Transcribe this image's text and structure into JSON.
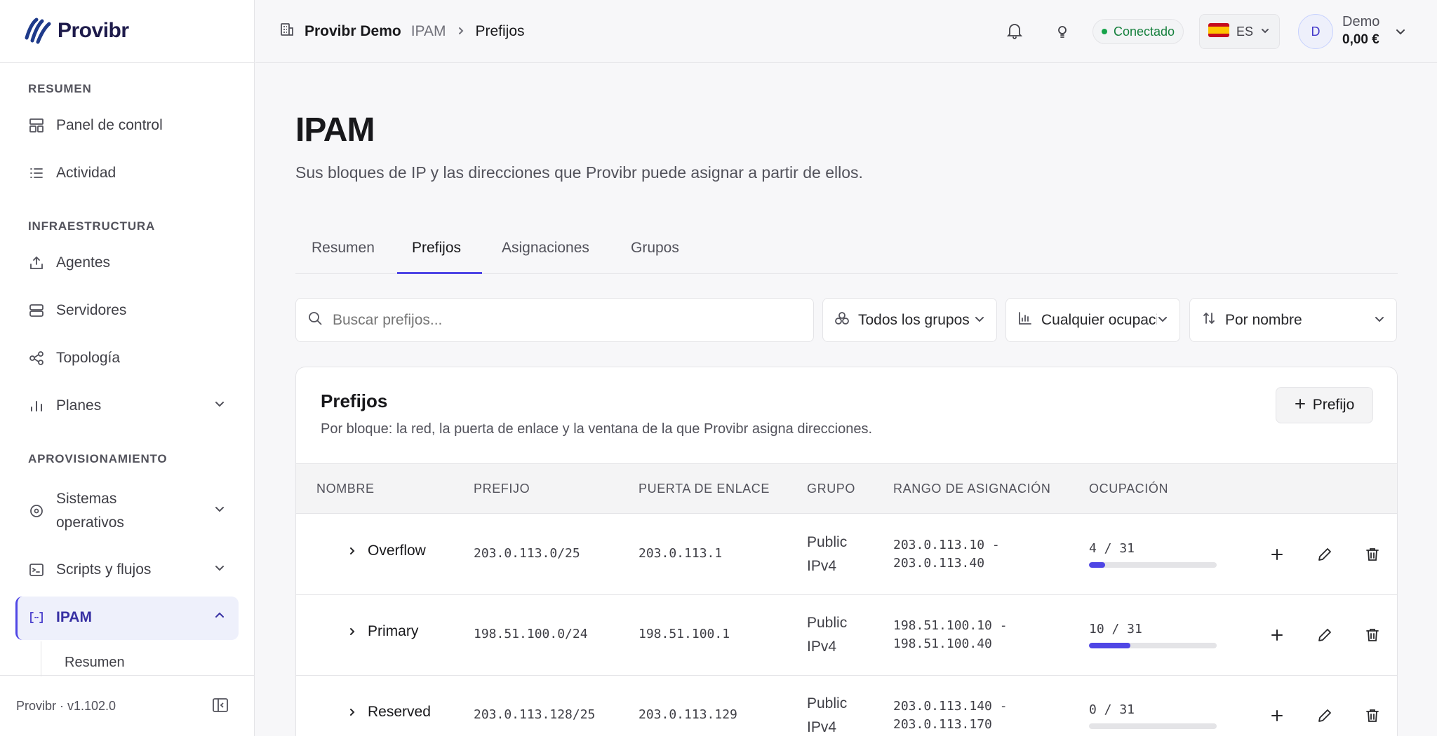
{
  "brand": {
    "name": "Provibr"
  },
  "sidebar": {
    "sections": {
      "resumen": "RESUMEN",
      "infra": "INFRAESTRUCTURA",
      "aprov": "APROVISIONAMIENTO"
    },
    "items": {
      "panel": "Panel de control",
      "actividad": "Actividad",
      "agentes": "Agentes",
      "servidores": "Servidores",
      "topologia": "Topología",
      "planes": "Planes",
      "so_line1": "Sistemas",
      "so_line2": "operativos",
      "scripts": "Scripts y flujos",
      "ipam": "IPAM",
      "sub_resumen": "Resumen"
    },
    "footer": {
      "version": "Provibr · v1.102.0"
    }
  },
  "topbar": {
    "org": "Provibr Demo",
    "crumb1": "IPAM",
    "crumb2": "Prefijos",
    "status": "Conectado",
    "status_color": "#16a34a",
    "lang": "ES",
    "avatar_initial": "D",
    "user_name": "Demo",
    "balance": "0,00 €"
  },
  "page": {
    "title": "IPAM",
    "subtitle": "Sus bloques de IP y las direcciones que Provibr puede asignar a partir de ellos.",
    "tabs": [
      "Resumen",
      "Prefijos",
      "Asignaciones",
      "Grupos"
    ],
    "active_tab": "Prefijos"
  },
  "filters": {
    "search_placeholder": "Buscar prefijos...",
    "group": "Todos los grupos",
    "occupancy": "Cualquier ocupación",
    "sort": "Por nombre"
  },
  "card": {
    "title": "Prefijos",
    "description": "Por bloque: la red, la puerta de enlace y la ventana de la que Provibr asigna direcciones.",
    "add_button": "Prefijo"
  },
  "table": {
    "headers": [
      "NOMBRE",
      "PREFIJO",
      "PUERTA DE ENLACE",
      "GRUPO",
      "RANGO DE ASIGNACIÓN",
      "OCUPACIÓN"
    ],
    "rows": [
      {
        "name": "Overflow",
        "prefix": "203.0.113.0/25",
        "gateway": "203.0.113.1",
        "group_l1": "Public",
        "group_l2": "IPv4",
        "range_l1": "203.0.113.10 -",
        "range_l2": "203.0.113.40",
        "occupancy": "4 / 31",
        "fill": 0.129
      },
      {
        "name": "Primary",
        "prefix": "198.51.100.0/24",
        "gateway": "198.51.100.1",
        "group_l1": "Public",
        "group_l2": "IPv4",
        "range_l1": "198.51.100.10 -",
        "range_l2": "198.51.100.40",
        "occupancy": "10 / 31",
        "fill": 0.323
      },
      {
        "name": "Reserved",
        "prefix": "203.0.113.128/25",
        "gateway": "203.0.113.129",
        "group_l1": "Public",
        "group_l2": "IPv4",
        "range_l1": "203.0.113.140 -",
        "range_l2": "203.0.113.170",
        "occupancy": "0 / 31",
        "fill": 0
      }
    ]
  },
  "colors": {
    "accent": "#4f46e5",
    "success": "#16a34a"
  }
}
